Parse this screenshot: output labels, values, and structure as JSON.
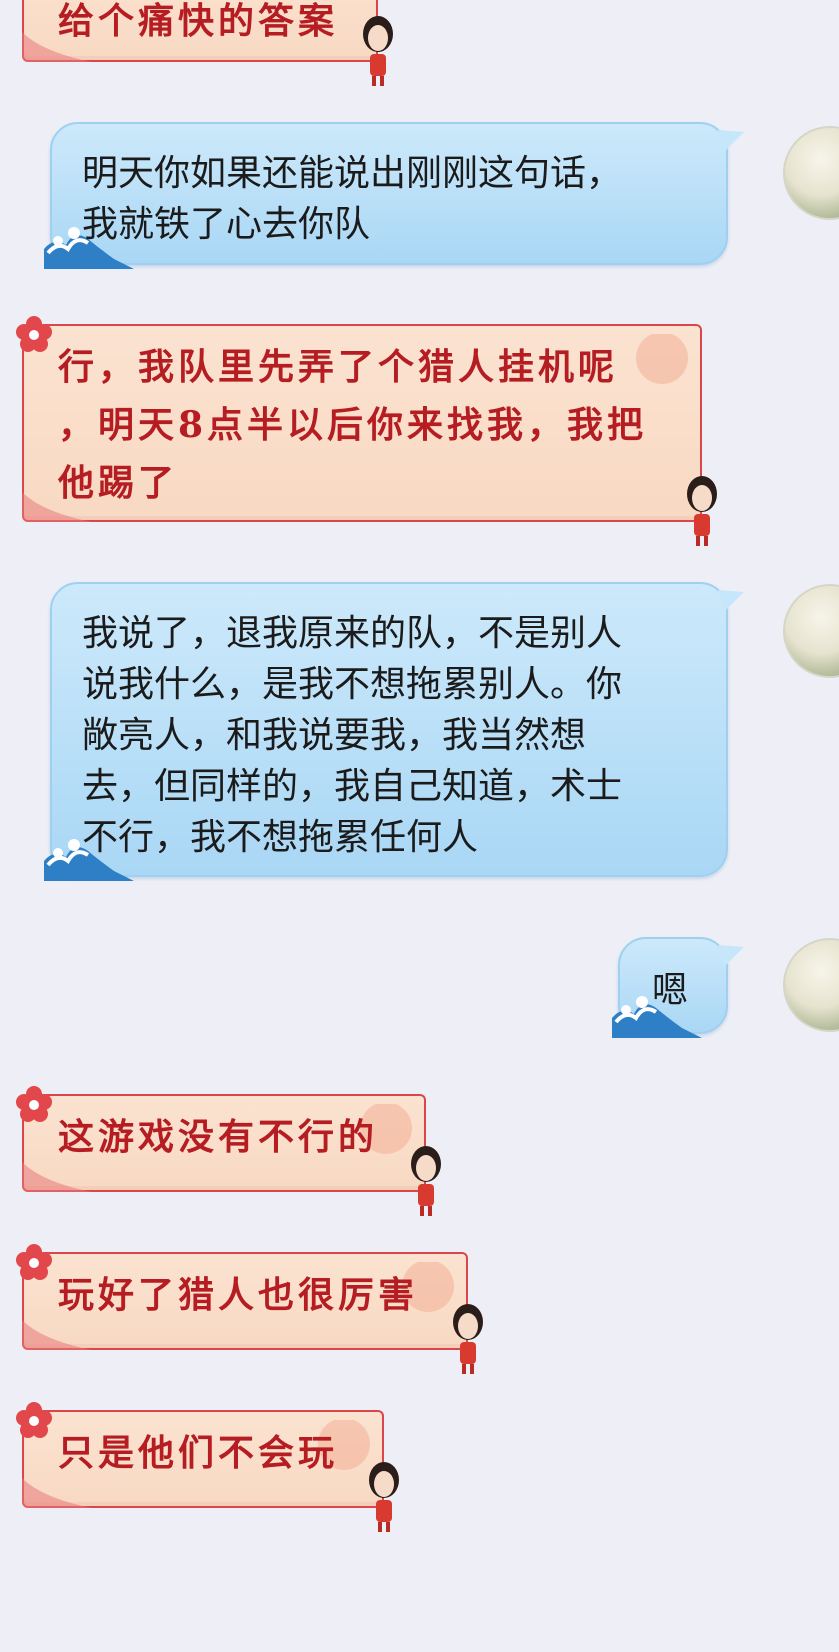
{
  "messages": [
    {
      "side": "left",
      "text": "给个痛快的答案"
    },
    {
      "side": "right",
      "text": "明天你如果还能说出刚刚这句话，\n我就铁了心去你队"
    },
    {
      "side": "left",
      "text": "行，我队里先弄了个猎人挂机呢\n，明天8点半以后你来找我，我把\n他踢了"
    },
    {
      "side": "right",
      "text": "我说了，退我原来的队，不是别人\n说我什么，是我不想拖累别人。你\n敞亮人，和我说要我，我当然想\n去，但同样的，我自己知道，术士\n不行，我不想拖累任何人"
    },
    {
      "side": "right",
      "text": "嗯"
    },
    {
      "side": "left",
      "text": "这游戏没有不行的"
    },
    {
      "side": "left",
      "text": "玩好了猎人也很厉害"
    },
    {
      "side": "left",
      "text": "只是他们不会玩"
    }
  ],
  "colors": {
    "background": "#eeeff6",
    "left_bubble": "#f8d9c3",
    "left_border": "#d9474a",
    "left_text": "#b51d22",
    "right_bubble": "#a9d7f5",
    "right_text": "#1b1b1b"
  },
  "icons": [
    "plum-flower-icon",
    "wave-icon",
    "avatar",
    "sticker-girl-icon"
  ]
}
